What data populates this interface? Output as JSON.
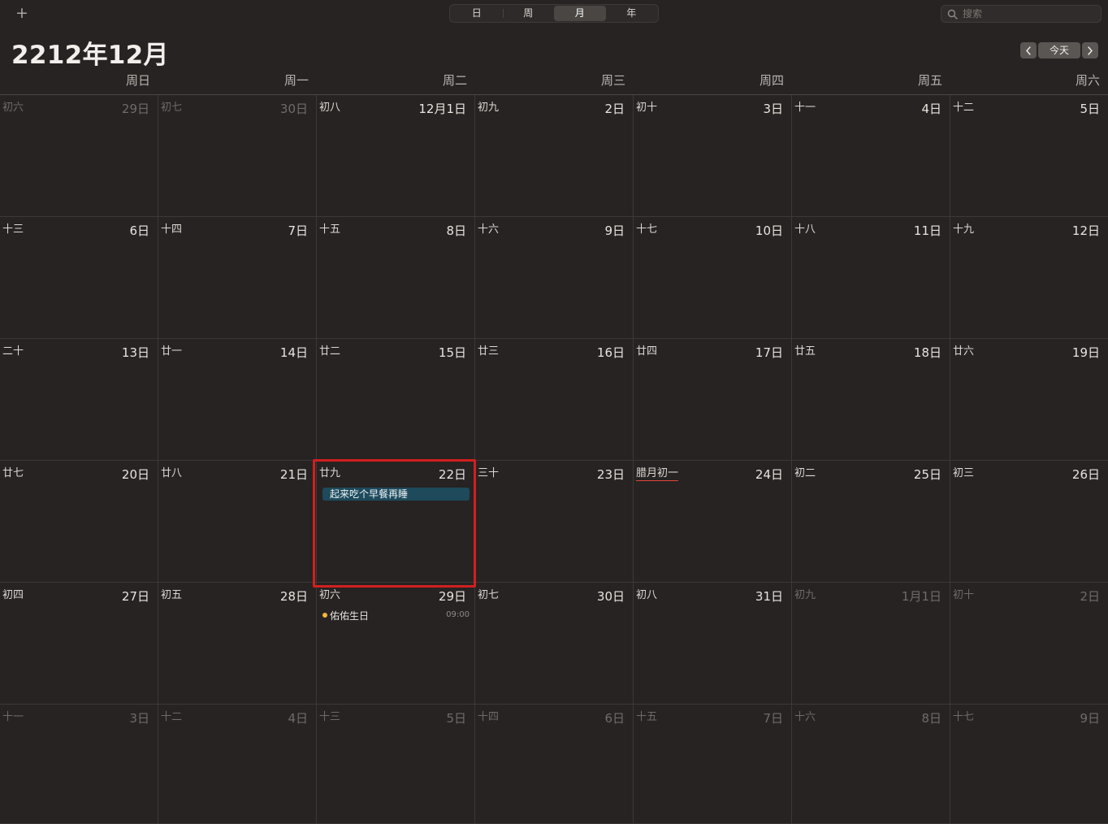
{
  "toolbar": {
    "add_label": "+",
    "views": [
      "日",
      "周",
      "月",
      "年"
    ],
    "active_view": 2,
    "search_placeholder": "搜索"
  },
  "header": {
    "title": "2212年12月",
    "today_label": "今天",
    "prev_icon": "chevron-left-icon",
    "next_icon": "chevron-right-icon"
  },
  "weekdays": [
    "周日",
    "周一",
    "周二",
    "周三",
    "周四",
    "周五",
    "周六"
  ],
  "weeks": [
    [
      {
        "lunar": "初六",
        "day": "29日",
        "faded": true
      },
      {
        "lunar": "初七",
        "day": "30日",
        "faded": true
      },
      {
        "lunar": "初八",
        "day": "12月1日"
      },
      {
        "lunar": "初九",
        "day": "2日"
      },
      {
        "lunar": "初十",
        "day": "3日"
      },
      {
        "lunar": "十一",
        "day": "4日"
      },
      {
        "lunar": "十二",
        "day": "5日"
      }
    ],
    [
      {
        "lunar": "十三",
        "day": "6日"
      },
      {
        "lunar": "十四",
        "day": "7日"
      },
      {
        "lunar": "十五",
        "day": "8日"
      },
      {
        "lunar": "十六",
        "day": "9日"
      },
      {
        "lunar": "十七",
        "day": "10日"
      },
      {
        "lunar": "十八",
        "day": "11日"
      },
      {
        "lunar": "十九",
        "day": "12日"
      }
    ],
    [
      {
        "lunar": "二十",
        "day": "13日"
      },
      {
        "lunar": "廿一",
        "day": "14日"
      },
      {
        "lunar": "廿二",
        "day": "15日"
      },
      {
        "lunar": "廿三",
        "day": "16日"
      },
      {
        "lunar": "廿四",
        "day": "17日"
      },
      {
        "lunar": "廿五",
        "day": "18日"
      },
      {
        "lunar": "廿六",
        "day": "19日"
      }
    ],
    [
      {
        "lunar": "廿七",
        "day": "20日"
      },
      {
        "lunar": "廿八",
        "day": "21日"
      },
      {
        "lunar": "廿九",
        "day": "22日",
        "event": {
          "type": "bar",
          "title": "起来吃个早餐再睡",
          "color": "#1e4a5c"
        }
      },
      {
        "lunar": "三十",
        "day": "23日"
      },
      {
        "lunar": "腊月初一",
        "day": "24日",
        "festival": true
      },
      {
        "lunar": "初二",
        "day": "25日"
      },
      {
        "lunar": "初三",
        "day": "26日"
      }
    ],
    [
      {
        "lunar": "初四",
        "day": "27日"
      },
      {
        "lunar": "初五",
        "day": "28日"
      },
      {
        "lunar": "初六",
        "day": "29日",
        "event": {
          "type": "dot",
          "title": "佑佑生日",
          "time": "09:00",
          "color": "#f5b53d"
        }
      },
      {
        "lunar": "初七",
        "day": "30日"
      },
      {
        "lunar": "初八",
        "day": "31日"
      },
      {
        "lunar": "初九",
        "day": "1月1日",
        "faded": true
      },
      {
        "lunar": "初十",
        "day": "2日",
        "faded": true
      }
    ],
    [
      {
        "lunar": "十一",
        "day": "3日",
        "faded": true
      },
      {
        "lunar": "十二",
        "day": "4日",
        "faded": true
      },
      {
        "lunar": "十三",
        "day": "5日",
        "faded": true
      },
      {
        "lunar": "十四",
        "day": "6日",
        "faded": true
      },
      {
        "lunar": "十五",
        "day": "7日",
        "faded": true
      },
      {
        "lunar": "十六",
        "day": "8日",
        "faded": true
      },
      {
        "lunar": "十七",
        "day": "9日",
        "faded": true
      }
    ]
  ]
}
